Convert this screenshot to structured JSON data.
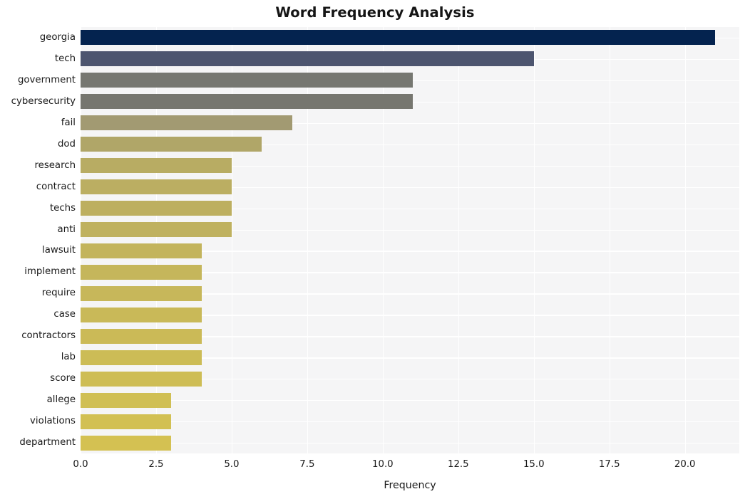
{
  "chart_data": {
    "type": "bar",
    "orientation": "horizontal",
    "title": "Word Frequency Analysis",
    "xlabel": "Frequency",
    "ylabel": "",
    "xlim": [
      0,
      21.8
    ],
    "xticks": [
      "0.0",
      "2.5",
      "5.0",
      "7.5",
      "10.0",
      "12.5",
      "15.0",
      "17.5",
      "20.0"
    ],
    "xtick_values": [
      0,
      2.5,
      5,
      7.5,
      10,
      12.5,
      15,
      17.5,
      20
    ],
    "grid": true,
    "legend": "none",
    "plot_background": "#f5f5f6",
    "grid_color": "#ffffff",
    "categories": [
      "georgia",
      "tech",
      "government",
      "cybersecurity",
      "fail",
      "dod",
      "research",
      "contract",
      "techs",
      "anti",
      "lawsuit",
      "implement",
      "require",
      "case",
      "contractors",
      "lab",
      "score",
      "allege",
      "violations",
      "department"
    ],
    "values": [
      21,
      15,
      11,
      11,
      7,
      6,
      5,
      5,
      5,
      5,
      4,
      4,
      4,
      4,
      4,
      4,
      4,
      3,
      3,
      3
    ],
    "bar_colors": [
      "#04234f",
      "#4d556f",
      "#767771",
      "#76766f",
      "#a29a72",
      "#b0a668",
      "#b8ac63",
      "#bbae62",
      "#bdaf60",
      "#bfb15f",
      "#c3b45c",
      "#c5b65b",
      "#c7b75a",
      "#c9b958",
      "#cbba57",
      "#ccbc56",
      "#cebd55",
      "#d0bf54",
      "#d2c053",
      "#d4c152"
    ]
  }
}
